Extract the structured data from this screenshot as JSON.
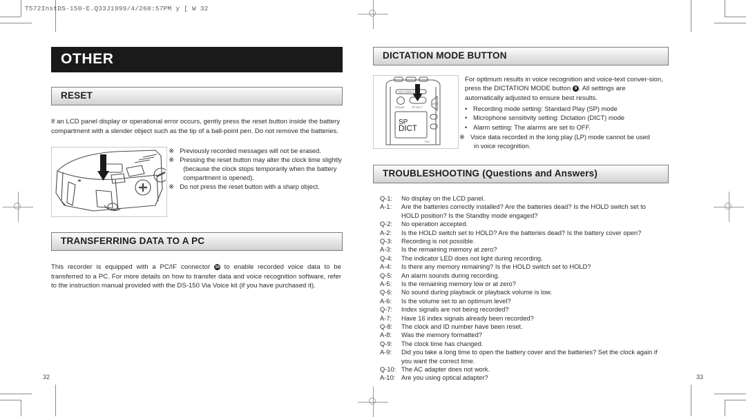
{
  "print_marks": {
    "file_stamp": "T572InstDS-150-E.Q33J1999/4/260:57PM y [ W 32"
  },
  "left_page": {
    "chapter_title": "OTHER",
    "page_number": "32",
    "sections": [
      {
        "heading": "RESET",
        "body": "If an LCD panel display or operational error occurs, gently press the reset button inside the battery compartment with a slender object such as the tip of a ball-point pen. Do not remove the batteries.",
        "illustration_name": "battery-compartment-reset-button",
        "notes": [
          "Previously recorded messages will not be erased.",
          "Pressing the reset button may alter the clock time slightly",
          "Do not press the reset button with a sharp object."
        ],
        "note_continuations": [
          "(because the clock stops temporarily when the battery",
          "compartment is opened)."
        ],
        "note_mark": "※"
      },
      {
        "heading": "TRANSFERRING DATA TO A PC",
        "body_part1": "This recorder is equipped with a PC/IF connector ",
        "body_inline_badge": "10",
        "body_part2": " to enable recorded voice data to be transferred to a PC. For more details on how to transfer data and voice recognition software, refer to the instruction manual provided with the DS-150 Via Voice kit (if you have purchased it)."
      }
    ]
  },
  "right_page": {
    "page_number": "33",
    "dictation": {
      "heading": "DICTATION MODE BUTTON",
      "illustration_name": "recorder-front-dictation-mode-button",
      "device_labels": {
        "brand": "OLYMPUS",
        "erase_button": "ERASE",
        "dict_button": "SP DICT",
        "lcd_line1": "SP",
        "lcd_line2": "DICT",
        "side_menu": "MENU",
        "bottom_mark": "REC"
      },
      "body_part1": "For optimum results in voice recognition and voice-text conver-sion, press the DICTATION MODE button ",
      "body_inline_badge": "9",
      "body_part2": ". All settings are automatically adjusted to ensure best results.",
      "bullets": [
        "Recording mode setting: Standard Play (SP) mode",
        "Microphone sensitivity setting: Dictation (DICT) mode",
        "Alarm setting: The alarms are set to OFF."
      ],
      "bullet_char": "•",
      "note_mark": "※",
      "note": "Voice data recorded in the long play (LP) mode cannot be used",
      "note_continuation": "in voice recognition."
    },
    "troubleshooting": {
      "heading": "TROUBLESHOOTING (Questions and Answers)",
      "entries": [
        {
          "label": "Q-1:",
          "text": "No display on the LCD panel."
        },
        {
          "label": "A-1:",
          "text": "Are the batteries correctly installed? Are the batteries dead? Is the HOLD switch set to",
          "continuation": "HOLD position? Is the Standby mode engaged?"
        },
        {
          "label": "Q-2:",
          "text": "No operation accepted."
        },
        {
          "label": "A-2:",
          "text": "Is the HOLD switch set to HOLD? Are the batteries dead? Is the battery cover open?"
        },
        {
          "label": "Q-3:",
          "text": "Recording is not possible."
        },
        {
          "label": "A-3:",
          "text": "Is the remaining memory at zero?"
        },
        {
          "label": "Q-4:",
          "text": "The indicator LED does not light during recording."
        },
        {
          "label": "A-4:",
          "text": "Is there any memory remaining? Is the HOLD switch set to HOLD?"
        },
        {
          "label": "Q-5:",
          "text": "An alarm sounds during recording."
        },
        {
          "label": "A-5:",
          "text": "Is the remaining memory low or at zero?"
        },
        {
          "label": "Q-6:",
          "text": "No sound during playback or playback volume is low."
        },
        {
          "label": "A-6:",
          "text": "Is the volume set to an optimum level?"
        },
        {
          "label": "Q-7:",
          "text": "Index signals are not being recorded?"
        },
        {
          "label": "A-7:",
          "text": "Have 16 index signals already been recorded?"
        },
        {
          "label": "Q-8:",
          "text": "The clock and ID number have been reset."
        },
        {
          "label": "A-8:",
          "text": "Was the memory formatted?"
        },
        {
          "label": "Q-9:",
          "text": "The clock time has changed."
        },
        {
          "label": "A-9:",
          "text": "Did you take a long time to open the battery cover and the  batteries? Set the clock again if",
          "continuation": "you want the correct time."
        },
        {
          "label": "Q-10:",
          "text": "The AC adapter does not work."
        },
        {
          "label": "A-10:",
          "text": "Are you using optical adapter?"
        }
      ]
    }
  }
}
